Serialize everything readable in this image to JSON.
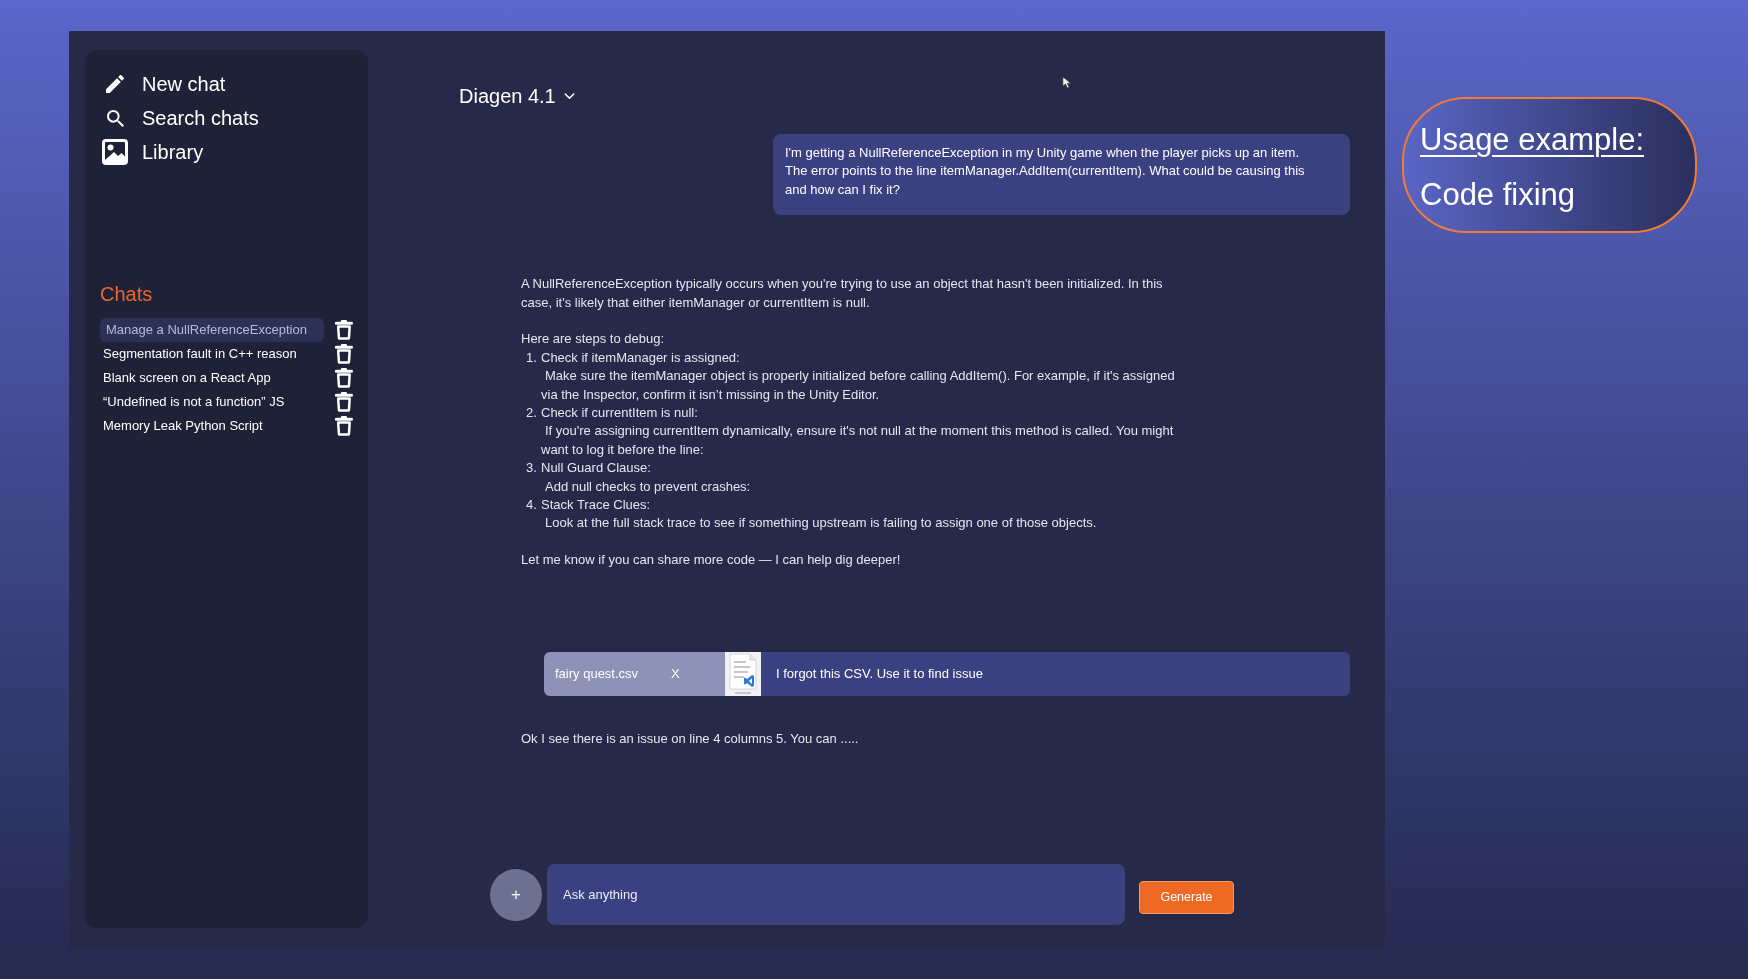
{
  "sidebar": {
    "nav": [
      {
        "kind": "compose",
        "label": "New chat"
      },
      {
        "kind": "search",
        "label": "Search chats"
      },
      {
        "kind": "library",
        "label": "Library"
      }
    ],
    "chats_heading": "Chats",
    "chats": [
      {
        "title": "Manage a NullReferenceException",
        "selected": true
      },
      {
        "title": "Segmentation fault in C++ reason",
        "selected": false
      },
      {
        "title": "Blank screen on a React App",
        "selected": false
      },
      {
        "title": "“Undefined is not a function” JS",
        "selected": false
      },
      {
        "title": "Memory Leak Python Script",
        "selected": false
      }
    ]
  },
  "header": {
    "model": "Diagen 4.1"
  },
  "messages": [
    {
      "kind": "user",
      "text": "I'm getting a NullReferenceException in my Unity game when the player picks up an item. The error points to the line itemManager.AddItem(currentItem). What could be causing this and how can I fix it?"
    },
    {
      "kind": "assistant",
      "blocks": [
        {
          "kind": "paragraph",
          "text": "A NullReferenceException typically occurs when you're trying to use an object that hasn't been initialized. In this case, it's likely that either itemManager or currentItem is null."
        },
        {
          "kind": "list",
          "heading": "Here are steps to debug:",
          "items": [
            {
              "number": "1.",
              "title": "Check if itemManager is assigned:",
              "detail": "Make sure the itemManager object is properly initialized before calling AddItem(). For example, if it's assigned via the Inspector, confirm it isn’t missing in the Unity Editor."
            },
            {
              "number": "2.",
              "title": "Check if currentItem is null:",
              "detail": "If you're assigning currentItem dynamically, ensure it's not null at the moment this method is called. You might want to log it before the line:"
            },
            {
              "number": "3.",
              "title": "Null Guard Clause:",
              "detail": "Add null checks to prevent crashes:"
            },
            {
              "number": "4.",
              "title": "Stack Trace Clues:",
              "detail": "Look at the full stack trace to see if something upstream is failing to assign one of those objects."
            }
          ]
        },
        {
          "kind": "paragraph",
          "text": "Let me know if you can share more code — I can help dig deeper!"
        }
      ]
    },
    {
      "kind": "attachment",
      "file_name": "fairy quest.csv",
      "remove": "X",
      "text": "I forgot this CSV. Use it to find issue"
    },
    {
      "kind": "assistant",
      "blocks": [
        {
          "kind": "paragraph",
          "text": "Ok I see there is an issue on line 4 columns 5. You can ....."
        }
      ]
    }
  ],
  "composer": {
    "add": "+",
    "placeholder": "Ask anything",
    "button": "Generate"
  },
  "callout": {
    "title": "Usage example:",
    "subtitle": "Code fixing"
  }
}
